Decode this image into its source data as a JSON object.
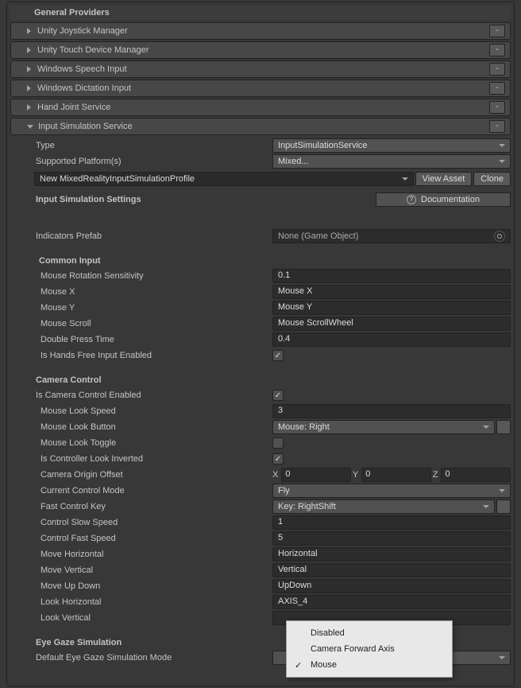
{
  "header": {
    "general_providers": "General Providers"
  },
  "foldouts": {
    "joystick": "Unity Joystick Manager",
    "touch": "Unity Touch Device Manager",
    "speech": "Windows Speech Input",
    "dictation": "Windows Dictation Input",
    "hand": "Hand Joint Service",
    "sim": "Input Simulation Service"
  },
  "minus": "-",
  "props": {
    "type": {
      "label": "Type",
      "value": "InputSimulationService"
    },
    "platforms": {
      "label": "Supported Platform(s)",
      "value": "Mixed..."
    },
    "profile": "New MixedRealityInputSimulationProfile",
    "view_asset": "View Asset",
    "clone": "Clone",
    "settings_title": "Input Simulation Settings",
    "doc": "Documentation",
    "indicators": {
      "label": "Indicators Prefab",
      "value": "None (Game Object)"
    }
  },
  "common": {
    "title": "Common Input",
    "mouse_rot": {
      "label": "Mouse Rotation Sensitivity",
      "value": "0.1"
    },
    "mouse_x": {
      "label": "Mouse X",
      "value": "Mouse X"
    },
    "mouse_y": {
      "label": "Mouse Y",
      "value": "Mouse Y"
    },
    "mouse_scroll": {
      "label": "Mouse Scroll",
      "value": "Mouse ScrollWheel"
    },
    "dbl_press": {
      "label": "Double Press Time",
      "value": "0.4"
    },
    "hands_free": {
      "label": "Is Hands Free Input Enabled",
      "checked": true
    }
  },
  "camera": {
    "title": "Camera Control",
    "enabled": {
      "label": "Is Camera Control Enabled",
      "checked": true
    },
    "look_speed": {
      "label": "Mouse Look Speed",
      "value": "3"
    },
    "look_button": {
      "label": "Mouse Look Button",
      "value": "Mouse: Right"
    },
    "look_toggle": {
      "label": "Mouse Look Toggle",
      "checked": false
    },
    "look_invert": {
      "label": "Is Controller Look Inverted",
      "checked": true
    },
    "origin": {
      "label": "Camera Origin Offset",
      "x": "0",
      "y": "0",
      "z": "0"
    },
    "x_label": "X",
    "y_label": "Y",
    "z_label": "Z",
    "control_mode": {
      "label": "Current Control Mode",
      "value": "Fly"
    },
    "fast_key": {
      "label": "Fast Control Key",
      "value": "Key: RightShift"
    },
    "slow_speed": {
      "label": "Control Slow Speed",
      "value": "1"
    },
    "fast_speed": {
      "label": "Control Fast Speed",
      "value": "5"
    },
    "move_h": {
      "label": "Move Horizontal",
      "value": "Horizontal"
    },
    "move_v": {
      "label": "Move Vertical",
      "value": "Vertical"
    },
    "move_ud": {
      "label": "Move Up Down",
      "value": "UpDown"
    },
    "look_h": {
      "label": "Look Horizontal",
      "value": "AXIS_4"
    },
    "look_v": {
      "label": "Look Vertical",
      "value": ""
    }
  },
  "eye": {
    "title": "Eye Gaze Simulation",
    "mode": {
      "label": "Default Eye Gaze Simulation Mode",
      "value": ""
    }
  },
  "popup": {
    "disabled": "Disabled",
    "cam_fwd": "Camera Forward Axis",
    "mouse": "Mouse"
  }
}
